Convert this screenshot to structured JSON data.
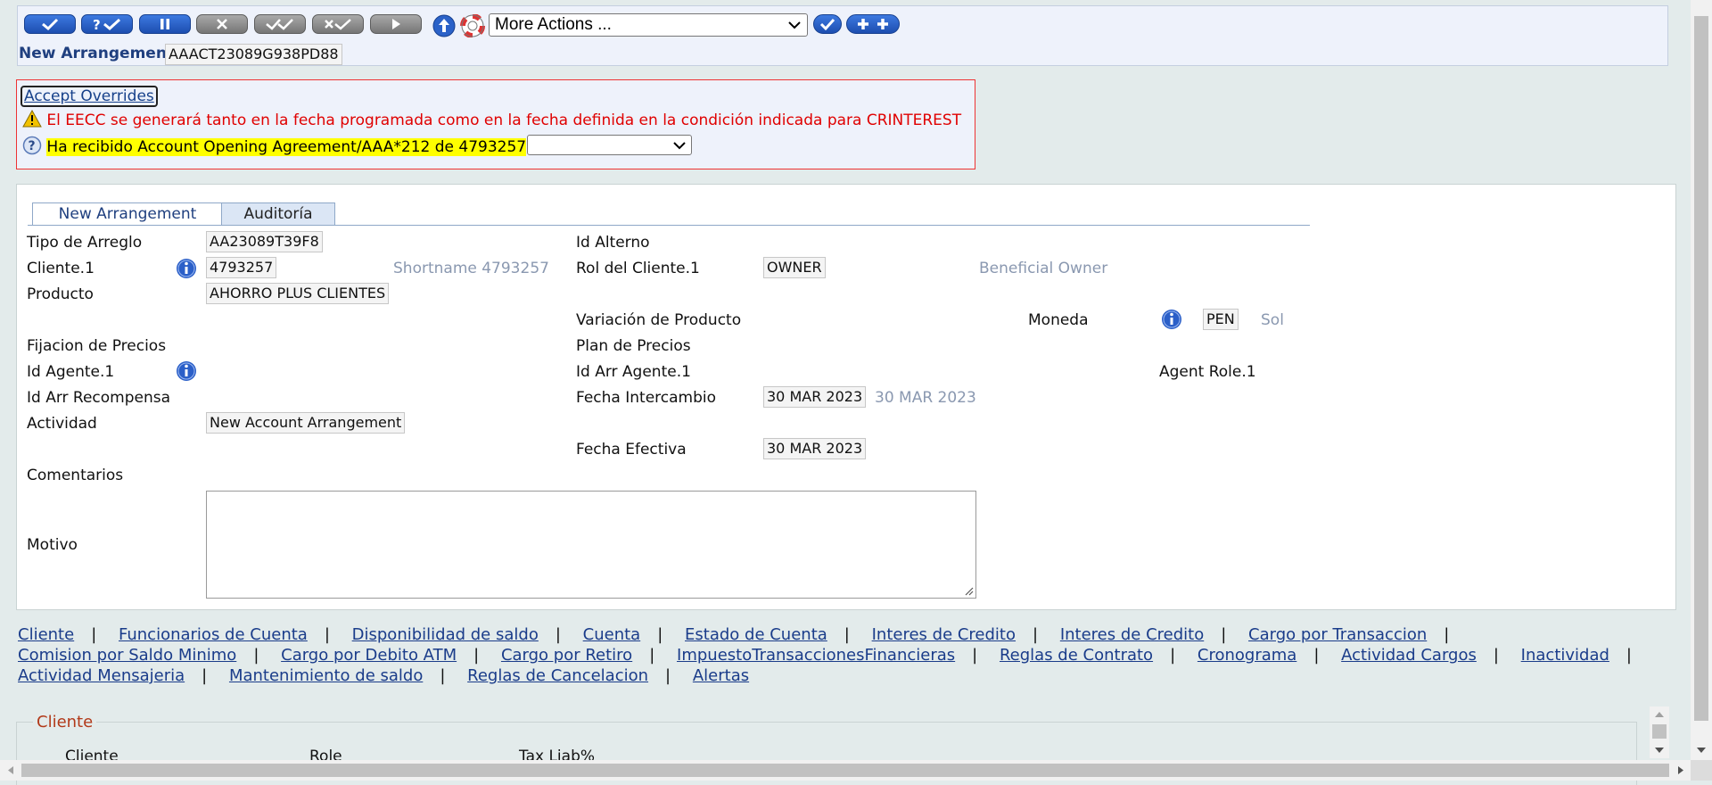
{
  "toolbar": {
    "buttons": [
      {
        "name": "commit-button",
        "icon": "check-icon",
        "color": "#2b62c8"
      },
      {
        "name": "validate-button",
        "icon": "question-check-icon",
        "color": "#2b62c8"
      },
      {
        "name": "hold-button",
        "icon": "pause-icon",
        "color": "#2b62c8"
      },
      {
        "name": "delete-button",
        "icon": "x-icon",
        "color": "#8c8c8c"
      },
      {
        "name": "authorise-button",
        "icon": "double-check-icon",
        "color": "#8c8c8c"
      },
      {
        "name": "reverse-button",
        "icon": "x-check-icon",
        "color": "#8c8c8c"
      },
      {
        "name": "next-button",
        "icon": "play-icon",
        "color": "#8c8c8c"
      }
    ],
    "more_actions": "More Actions ...",
    "arrangement_label": "New Arrangement",
    "arrangement_id": "AAACT23089G938PD88"
  },
  "overrides": {
    "accept_label": "Accept Overrides",
    "warning_text": "El EECC se generará tanto en la fecha programada como en la fecha definida en la condición indicada para CRINTEREST",
    "question_text": "Ha recibido Account Opening Agreement/AAA*212 de 4793257",
    "question_select_value": ""
  },
  "tabs": [
    {
      "label": "New Arrangement",
      "active": true
    },
    {
      "label": "Auditoría",
      "active": false
    }
  ],
  "form": {
    "tipo_arreglo": {
      "label": "Tipo de Arreglo",
      "value": "AA23089T39F8"
    },
    "id_alterno": {
      "label": "Id Alterno"
    },
    "cliente": {
      "label": "Cliente.1",
      "value": "4793257",
      "desc": "Shortname 4793257"
    },
    "rol_cliente": {
      "label": "Rol del Cliente.1",
      "value": "OWNER",
      "desc": "Beneficial Owner"
    },
    "producto": {
      "label": "Producto",
      "value": "AHORRO PLUS CLIENTES"
    },
    "variacion": {
      "label": "Variación de Producto"
    },
    "moneda": {
      "label": "Moneda",
      "value": "PEN",
      "desc": "Sol"
    },
    "fijacion": {
      "label": "Fijacion de Precios"
    },
    "plan_precios": {
      "label": "Plan de Precios"
    },
    "id_agente": {
      "label": "Id Agente.1"
    },
    "id_arr_agente": {
      "label": "Id Arr Agente.1"
    },
    "agent_role": {
      "label": "Agent Role.1"
    },
    "id_arr_recompensa": {
      "label": "Id Arr Recompensa"
    },
    "fecha_intercambio": {
      "label": "Fecha Intercambio",
      "value": "30 MAR 2023",
      "desc": "30 MAR 2023"
    },
    "actividad": {
      "label": "Actividad",
      "value": "New Account Arrangement"
    },
    "fecha_efectiva": {
      "label": "Fecha Efectiva",
      "value": "30 MAR 2023"
    },
    "comentarios": {
      "label": "Comentarios"
    },
    "motivo": {
      "label": "Motivo",
      "value": ""
    }
  },
  "links": [
    [
      "Cliente",
      "Funcionarios de Cuenta",
      "Disponibilidad de saldo",
      "Cuenta",
      "Estado de Cuenta",
      "Interes de Credito",
      "Interes de Credito",
      "Cargo por Transaccion"
    ],
    [
      "Comision por Saldo Minimo",
      "Cargo por Debito ATM",
      "Cargo por Retiro",
      "ImpuestoTransaccionesFinancieras",
      "Reglas de Contrato",
      "Cronograma",
      "Actividad Cargos",
      "Inactividad"
    ],
    [
      "Actividad Mensajeria",
      "Mantenimiento de saldo",
      "Reglas de Cancelacion",
      "Alertas"
    ]
  ],
  "cliente_section": {
    "legend": "Cliente",
    "columns": [
      "Cliente",
      "Role",
      "Tax Liab%"
    ]
  }
}
